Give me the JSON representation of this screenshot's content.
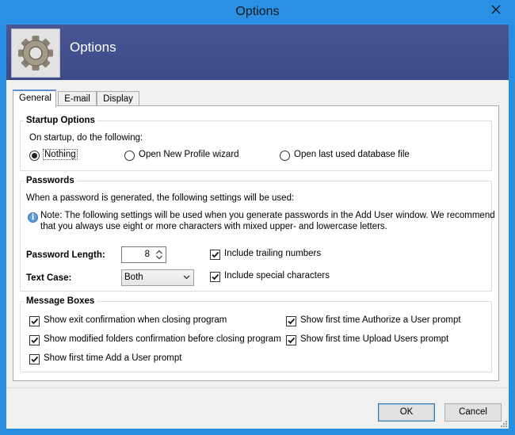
{
  "window": {
    "title": "Options",
    "header_title": "Options"
  },
  "icons": {
    "logo": "gear-icon",
    "close": "close-icon",
    "info": "info-icon"
  },
  "colors": {
    "titlebar": "#2b8fe3",
    "header": "#424f8e",
    "client": "#f0f0f0"
  },
  "tabs": [
    {
      "label": "General",
      "active": true
    },
    {
      "label": "E-mail",
      "active": false
    },
    {
      "label": "Display",
      "active": false
    }
  ],
  "startup": {
    "legend": "Startup Options",
    "prompt": "On startup, do the following:",
    "options": [
      {
        "label": "Nothing",
        "checked": true
      },
      {
        "label": "Open New Profile wizard",
        "checked": false
      },
      {
        "label": "Open last used database file",
        "checked": false
      }
    ]
  },
  "passwords": {
    "legend": "Passwords",
    "intro": "When a password is generated, the following settings will be used:",
    "note_line1": "Note: The following settings will be used when you generate passwords in the Add User window. We recommend",
    "note_line2": "that you always use eight or more characters with mixed upper- and lowercase letters.",
    "length_label": "Password Length:",
    "length_value": "8",
    "case_label": "Text Case:",
    "case_value": "Both",
    "include_numbers": {
      "label": "Include trailing numbers",
      "checked": true
    },
    "include_special": {
      "label": "Include special characters",
      "checked": true
    }
  },
  "messages": {
    "legend": "Message Boxes",
    "items": [
      {
        "label": "Show exit confirmation when closing program",
        "checked": true
      },
      {
        "label": "Show modified folders confirmation before closing program",
        "checked": true
      },
      {
        "label": "Show first time Add a User prompt",
        "checked": true
      },
      {
        "label": "Show first time Authorize a User prompt",
        "checked": true
      },
      {
        "label": "Show first time Upload Users prompt",
        "checked": true
      }
    ]
  },
  "buttons": {
    "ok": "OK",
    "cancel": "Cancel"
  }
}
